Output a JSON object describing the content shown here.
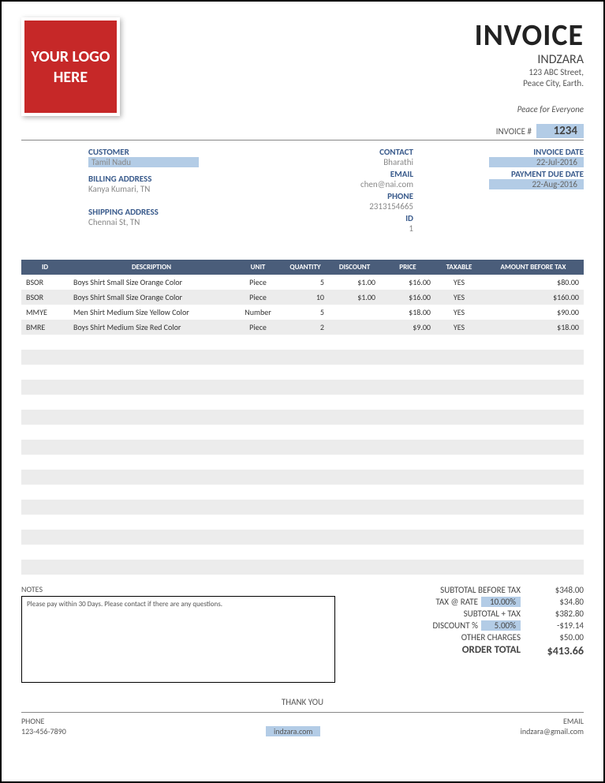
{
  "logo": {
    "text": "YOUR LOGO HERE"
  },
  "header": {
    "title": "INVOICE",
    "company": "INDZARA",
    "addr1": "123 ABC Street,",
    "addr2": "Peace City, Earth.",
    "tagline": "Peace for Everyone"
  },
  "invnum": {
    "label": "INVOICE #",
    "value": "1234"
  },
  "customer": {
    "label": "CUSTOMER",
    "value": "Tamil Nadu",
    "billing_label": "BILLING ADDRESS",
    "billing": "Kanya Kumari, TN",
    "shipping_label": "SHIPPING ADDRESS",
    "shipping": "Chennai St, TN"
  },
  "contact": {
    "contact_label": "CONTACT",
    "contact": "Bharathi",
    "email_label": "EMAIL",
    "email": "chen@nai.com",
    "phone_label": "PHONE",
    "phone": "2313154665",
    "id_label": "ID",
    "id": "1"
  },
  "dates": {
    "inv_date_label": "INVOICE DATE",
    "inv_date": "22-Jul-2016",
    "due_label": "PAYMENT DUE DATE",
    "due": "22-Aug-2016"
  },
  "table": {
    "headers": {
      "id": "ID",
      "desc": "DESCRIPTION",
      "unit": "UNIT",
      "qty": "QUANTITY",
      "disc": "DISCOUNT",
      "price": "PRICE",
      "tax": "TAXABLE",
      "amt": "AMOUNT BEFORE TAX"
    },
    "rows": [
      {
        "id": "BSOR",
        "desc": "Boys Shirt Small Size Orange Color",
        "unit": "Piece",
        "qty": "5",
        "disc": "$1.00",
        "price": "$16.00",
        "tax": "YES",
        "amt": "$80.00"
      },
      {
        "id": "BSOR",
        "desc": "Boys Shirt Small Size Orange Color",
        "unit": "Piece",
        "qty": "10",
        "disc": "$1.00",
        "price": "$16.00",
        "tax": "YES",
        "amt": "$160.00"
      },
      {
        "id": "MMYE",
        "desc": "Men Shirt Medium Size Yellow Color",
        "unit": "Number",
        "qty": "5",
        "disc": "",
        "price": "$18.00",
        "tax": "YES",
        "amt": "$90.00"
      },
      {
        "id": "BMRE",
        "desc": "Boys Shirt Medium Size Red Color",
        "unit": "Piece",
        "qty": "2",
        "disc": "",
        "price": "$9.00",
        "tax": "YES",
        "amt": "$18.00"
      }
    ]
  },
  "notes": {
    "label": "NOTES",
    "text": "Please pay within 30 Days. Please contact if there are any questions."
  },
  "totals": {
    "subtotal_label": "SUBTOTAL BEFORE TAX",
    "subtotal": "$348.00",
    "taxrate_label": "TAX @ RATE",
    "taxrate_pct": "10.00%",
    "tax": "$34.80",
    "subtax_label": "SUBTOTAL + TAX",
    "subtax": "$382.80",
    "disc_label": "DISCOUNT %",
    "disc_pct": "5.00%",
    "disc": "-$19.14",
    "other_label": "OTHER CHARGES",
    "other": "$50.00",
    "order_label": "ORDER TOTAL",
    "order": "$413.66"
  },
  "thank": "THANK YOU",
  "footer": {
    "phone_label": "PHONE",
    "phone": "123-456-7890",
    "site": "indzara.com",
    "email_label": "EMAIL",
    "email": "indzara@gmail.com"
  }
}
